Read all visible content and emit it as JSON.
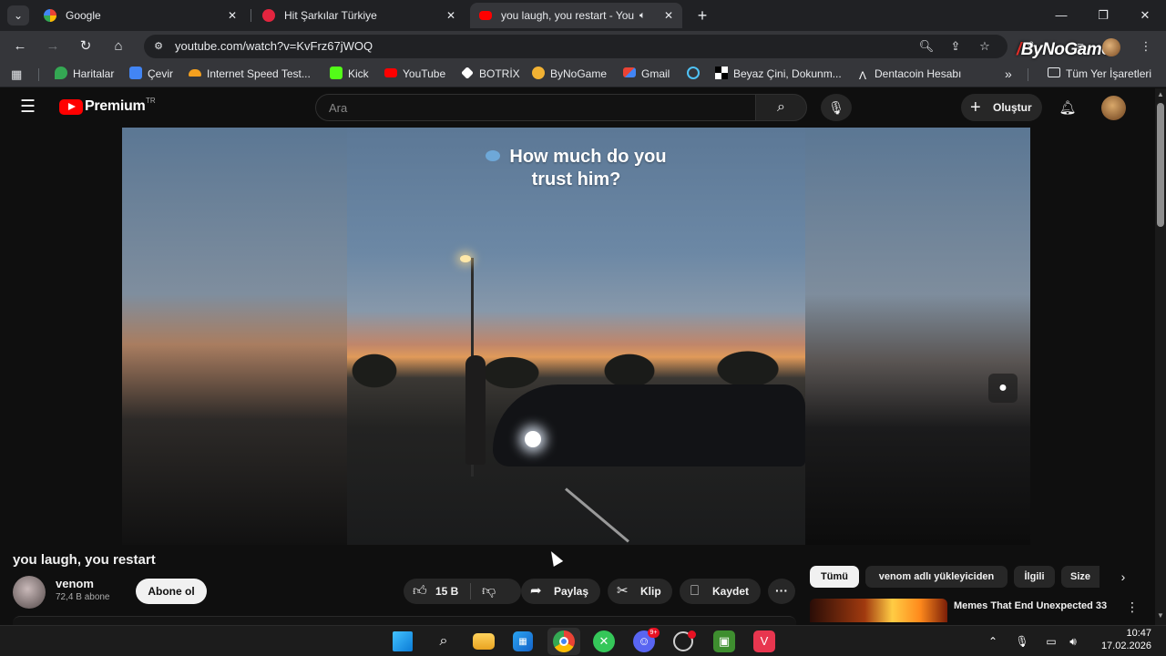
{
  "browser": {
    "tabs": [
      {
        "title": "Google",
        "favicon": "google-icon",
        "active": false
      },
      {
        "title": "Hit Şarkılar Türkiye",
        "favicon": "youtube-music-icon",
        "active": false
      },
      {
        "title": "you laugh, you restart - You",
        "favicon": "youtube-icon",
        "active": true,
        "audio": "speaker-icon"
      }
    ],
    "url": "youtube.com/watch?v=KvFrz67jWOQ",
    "extension_logo": {
      "text": "ByNoGame",
      "slash": "/"
    },
    "bookmarks": [
      {
        "label": "Haritalar",
        "icon": "maps-icon",
        "color": "#34a853"
      },
      {
        "label": "Çevir",
        "icon": "translate-icon",
        "color": "#4285f4"
      },
      {
        "label": "Internet Speed Test...",
        "icon": "cloud-icon",
        "color": "#f4a01f"
      },
      {
        "label": "Kick",
        "icon": "kick-icon",
        "color": "#53fc18"
      },
      {
        "label": "YouTube",
        "icon": "youtube-icon",
        "color": "#ff0000"
      },
      {
        "label": "BOTRİX",
        "icon": "botrix-icon",
        "color": "#ffffff"
      },
      {
        "label": "ByNoGame",
        "icon": "bynogame-icon",
        "color": "#f2b233"
      },
      {
        "label": "Gmail",
        "icon": "gmail-icon",
        "color": "#ea4335"
      },
      {
        "label": "",
        "icon": "eye-icon",
        "color": "#4fc3f7"
      },
      {
        "label": "Beyaz Çini, Dokunm...",
        "icon": "checker-icon",
        "color": "#ffffff"
      },
      {
        "label": "Dentacoin Hesabı",
        "icon": "dentacoin-icon",
        "color": "#ffffff"
      }
    ],
    "bookmarks_overflow": "»",
    "all_bookmarks": "Tüm Yer İşaretleri"
  },
  "youtube": {
    "logo_text": "Premium",
    "country_code": "TR",
    "search_placeholder": "Ara",
    "create_label": "Oluştur",
    "video": {
      "caption_line1": "How much do you",
      "caption_line2": "trust him?",
      "title": "you laugh, you restart",
      "channel": "venom",
      "subscribers": "72,4 B abone",
      "subscribe_label": "Abone ol",
      "likes": "15 B",
      "share_label": "Paylaş",
      "clip_label": "Klip",
      "save_label": "Kaydet",
      "more": "···"
    },
    "chips": [
      "Tümü",
      "venom adlı yükleyiciden",
      "İlgili",
      "Size"
    ],
    "recommendation": {
      "title": "Memes That End Unexpected 33"
    }
  },
  "taskbar": {
    "apps": [
      "windows-start-icon",
      "search-icon",
      "file-explorer-icon",
      "microsoft-store-icon",
      "chrome-icon",
      "xbox-icon",
      "discord-icon",
      "steam-icon",
      "nvidia-icon",
      "valorant-icon"
    ],
    "discord_badge": "9+",
    "time": "10:47",
    "date": "17.02.2026"
  }
}
